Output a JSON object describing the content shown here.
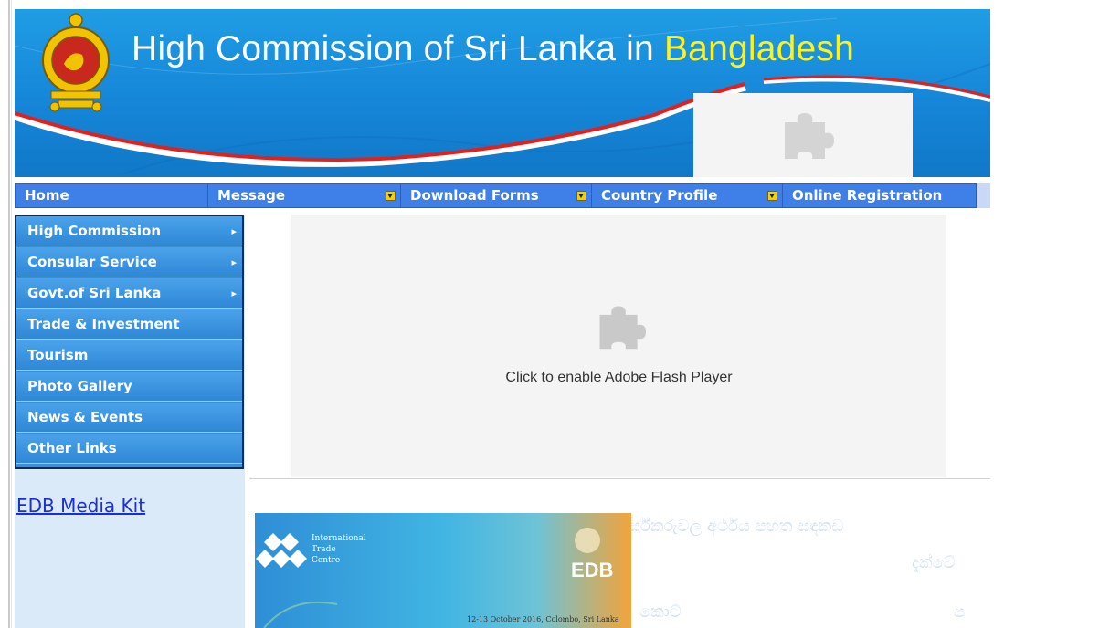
{
  "banner": {
    "title_main": "High Commission of Sri Lanka in ",
    "title_country": "Bangladesh"
  },
  "nav": {
    "items": [
      {
        "label": "Home",
        "has_dropdown": false
      },
      {
        "label": "Message",
        "has_dropdown": true
      },
      {
        "label": "Download Forms",
        "has_dropdown": true
      },
      {
        "label": "Country Profile",
        "has_dropdown": true
      },
      {
        "label": "Online Registration",
        "has_dropdown": false
      }
    ]
  },
  "sidebar": {
    "items": [
      {
        "label": "High Commission",
        "has_submenu": true
      },
      {
        "label": "Consular Service",
        "has_submenu": true
      },
      {
        "label": "Govt.of Sri Lanka",
        "has_submenu": true
      },
      {
        "label": "Trade & Investment",
        "has_submenu": false
      },
      {
        "label": "Tourism",
        "has_submenu": false
      },
      {
        "label": "Photo Gallery",
        "has_submenu": false
      },
      {
        "label": "News & Events",
        "has_submenu": false
      },
      {
        "label": "Other Links",
        "has_submenu": false
      }
    ],
    "edb_link": "EDB Media Kit"
  },
  "flash": {
    "message": "Click to enable Adobe Flash Player"
  },
  "edb_banner": {
    "org_line1": "International",
    "org_line2": "Trade",
    "org_line3": "Centre",
    "logo_text": "EDB",
    "date_text": "12-13 October 2016, Colombo, Sri Lanka"
  },
  "ghost_text": {
    "line1": "ර්ස්කරුවල  අර්ථය  පහත  සඳකඩ",
    "line2": "දැක්වේ",
    "line3": "කොට්",
    "line4": "ප"
  },
  "colors": {
    "banner_blue": "#1686d8",
    "nav_blue": "#3f7fe8",
    "sidebar_blue": "#3b8ed8",
    "title_yellow": "#fff21a",
    "link_blue": "#1a2fd6"
  }
}
